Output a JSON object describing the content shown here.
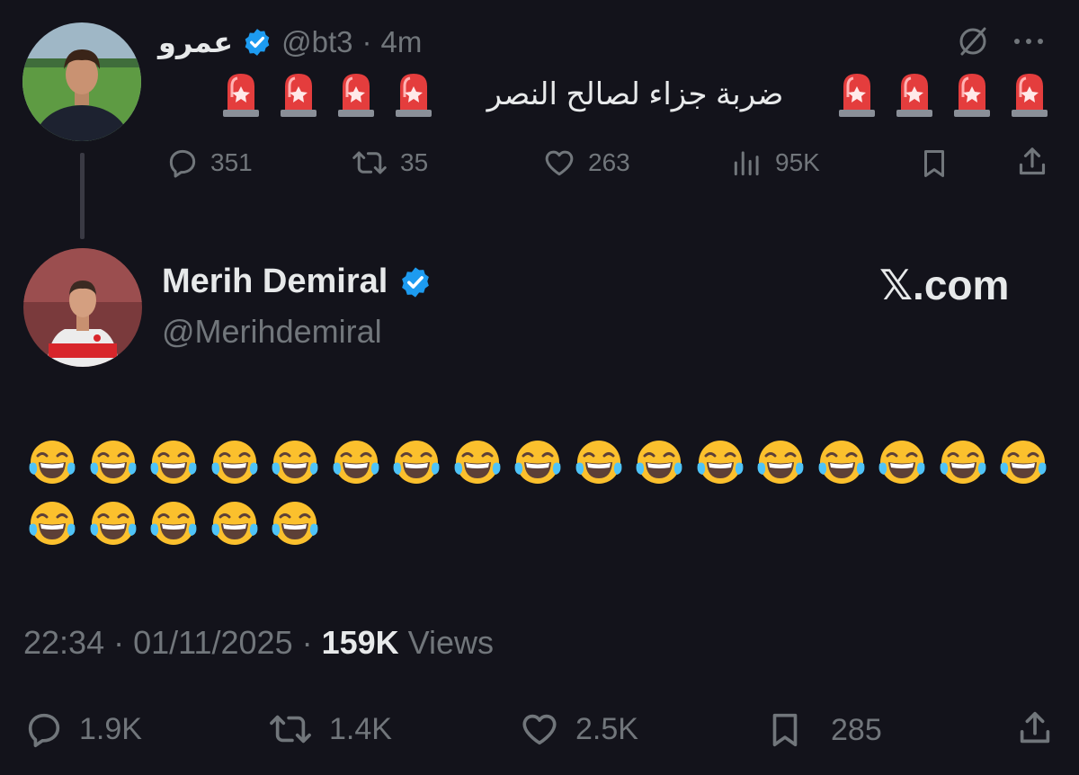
{
  "tweet1": {
    "display_name": "عمرو",
    "handle": "@bt3",
    "separator": "·",
    "time": "4m",
    "text": "ضربة جزاء لصالح النصر",
    "siren_emoji_count_left": 4,
    "siren_emoji_count_right": 4,
    "stats": {
      "replies": "351",
      "reposts": "35",
      "likes": "263",
      "views": "95K"
    }
  },
  "tweet2": {
    "display_name": "Merih Demiral",
    "handle": "@Merihdemiral",
    "watermark": "𝕏.com",
    "emoji_name": "face-with-tears-of-joy",
    "emoji_count": 22,
    "timestamp": "22:34 · 01/11/2025 ·",
    "views_count": "159K",
    "views_label": "Views",
    "stats": {
      "replies": "1.9K",
      "reposts": "1.4K",
      "likes": "2.5K",
      "bookmarks": "285"
    }
  },
  "colors": {
    "background": "#13131b",
    "text_primary": "#e7e9ea",
    "text_muted": "#71767b",
    "verified_blue": "#1d9bf0"
  }
}
